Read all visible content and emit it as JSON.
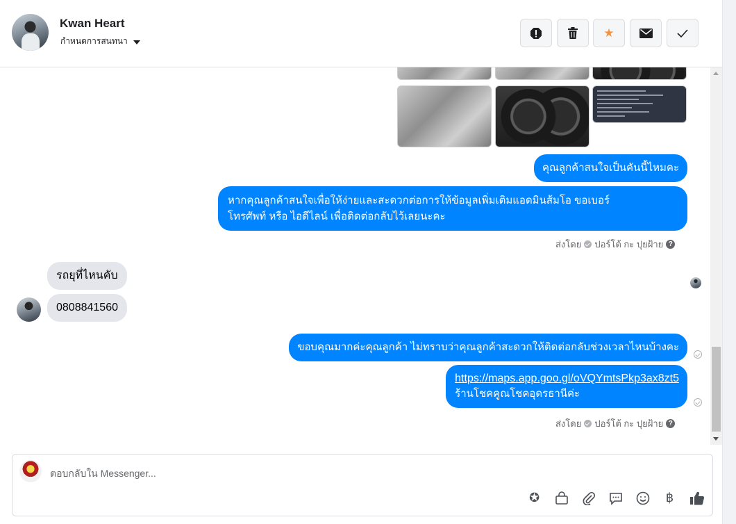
{
  "header": {
    "contact_name": "Kwan Heart",
    "assign_label": "กำหนดการสนทนา",
    "actions": [
      {
        "icon": "alert-octagon-icon",
        "glyph": "!"
      },
      {
        "icon": "trash-icon",
        "glyph": "🗑"
      },
      {
        "icon": "star-icon",
        "glyph": "★"
      },
      {
        "icon": "envelope-icon",
        "glyph": "✉"
      },
      {
        "icon": "checkmark-icon",
        "glyph": "✓"
      }
    ]
  },
  "thread": {
    "messages": [
      {
        "from": "page",
        "text": "คุณลูกค้าสนใจเป็นคันนี้ไหมคะ"
      },
      {
        "from": "page",
        "line1": "หากคุณลูกค้าสนใจเพื่อให้ง่ายและสะดวกต่อการให้ข้อมูลเพิ่มเติมแอดมินส้มโอ ขอเบอร์",
        "line2": "โทรศัพท์ หรือ ไอดีไลน์ เพื่อติดต่อกลับไว้เลยนะคะ"
      },
      {
        "from": "customer",
        "text": "รถยุที่ไหนคับ"
      },
      {
        "from": "customer",
        "text": "0808841560"
      },
      {
        "from": "page",
        "text": "ขอบคุณมากค่ะคุณลูกค้า ไม่ทราบว่าคุณลูกค้าสะดวกให้ติดต่อกลับช่วงเวลาไหนบ้างคะ"
      },
      {
        "from": "page",
        "link": "https://maps.app.goo.gl/oVQYmtsPkp3ax8zt5",
        "text": "ร้านโชคคูณโชคอุดรธานีค่ะ"
      }
    ],
    "sent_by_label": "ส่งโดย",
    "sender_name": "ปอร์โต้ กะ ปุยฝ้าย",
    "help_glyph": "?"
  },
  "composer": {
    "placeholder": "ตอบกลับใน Messenger...",
    "tools": [
      {
        "icon": "saved-reply-icon",
        "glyph": "✪"
      },
      {
        "icon": "shopping-bag-icon",
        "glyph": "👜"
      },
      {
        "icon": "paperclip-icon",
        "glyph": "📎"
      },
      {
        "icon": "chat-bubble-icon",
        "glyph": "💬"
      },
      {
        "icon": "emoji-icon",
        "glyph": "☺"
      },
      {
        "icon": "baht-icon",
        "glyph": "฿"
      },
      {
        "icon": "thumbs-up-icon",
        "glyph": "👍"
      }
    ]
  }
}
